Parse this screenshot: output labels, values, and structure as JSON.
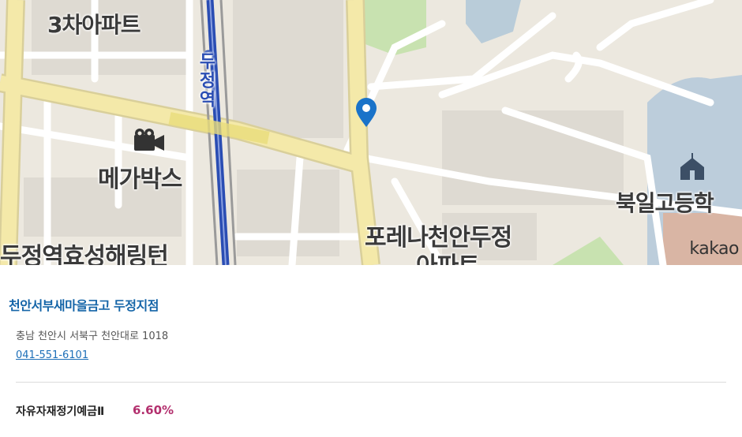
{
  "map": {
    "labels": {
      "apt_top": "3차아파트",
      "station": "두정역",
      "cinema": "메가박스",
      "school": "북일고등학",
      "forena": "포레나천안두정",
      "forena_2": "아파트",
      "hyosung": "두정역효성해링턴"
    },
    "attribution": "kakao",
    "marker_icon": "location-pin-icon",
    "cinema_icon": "movie-camera-icon",
    "school_icon": "school-icon",
    "colors": {
      "pin": "#1a73c9",
      "subway": "#2a4db3",
      "road_major": "#f3e7a6",
      "water": "#b9ccd9",
      "park": "#c8e2b0"
    }
  },
  "branch": {
    "name": "천안서부새마을금고 두정지점",
    "address": "충남 천안시 서북구 천안대로 1018",
    "phone": "041-551-6101"
  },
  "product": {
    "name": "자유자재정기예금Ⅱ",
    "rate": "6.60%"
  }
}
